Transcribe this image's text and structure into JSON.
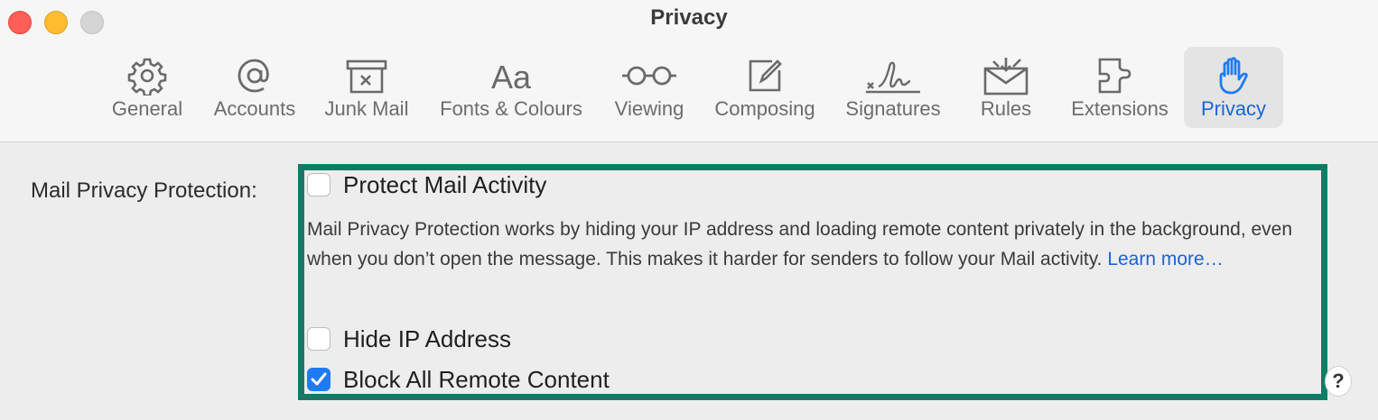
{
  "window": {
    "title": "Privacy"
  },
  "toolbar": {
    "tabs": [
      {
        "label": "General",
        "icon": "gear-icon"
      },
      {
        "label": "Accounts",
        "icon": "at-icon"
      },
      {
        "label": "Junk Mail",
        "icon": "junk-mail-icon"
      },
      {
        "label": "Fonts & Colours",
        "icon": "fonts-icon"
      },
      {
        "label": "Viewing",
        "icon": "glasses-icon"
      },
      {
        "label": "Composing",
        "icon": "compose-icon"
      },
      {
        "label": "Signatures",
        "icon": "signature-icon"
      },
      {
        "label": "Rules",
        "icon": "rules-icon"
      },
      {
        "label": "Extensions",
        "icon": "puzzle-icon"
      },
      {
        "label": "Privacy",
        "icon": "hand-icon",
        "active": true
      }
    ]
  },
  "privacy": {
    "section_label": "Mail Privacy Protection:",
    "protect_mail_activity": {
      "label": "Protect Mail Activity",
      "checked": false
    },
    "description": "Mail Privacy Protection works by hiding your IP address and loading remote content privately in the background, even when you don’t open the message. This makes it harder for senders to follow your Mail activity.",
    "learn_more": "Learn more…",
    "hide_ip": {
      "label": "Hide IP Address",
      "checked": false
    },
    "block_remote": {
      "label": "Block All Remote Content",
      "checked": true
    },
    "help": "?"
  },
  "colors": {
    "accent": "#1f7bf4",
    "highlight_border": "#0f7d66",
    "link": "#1a64d6"
  }
}
